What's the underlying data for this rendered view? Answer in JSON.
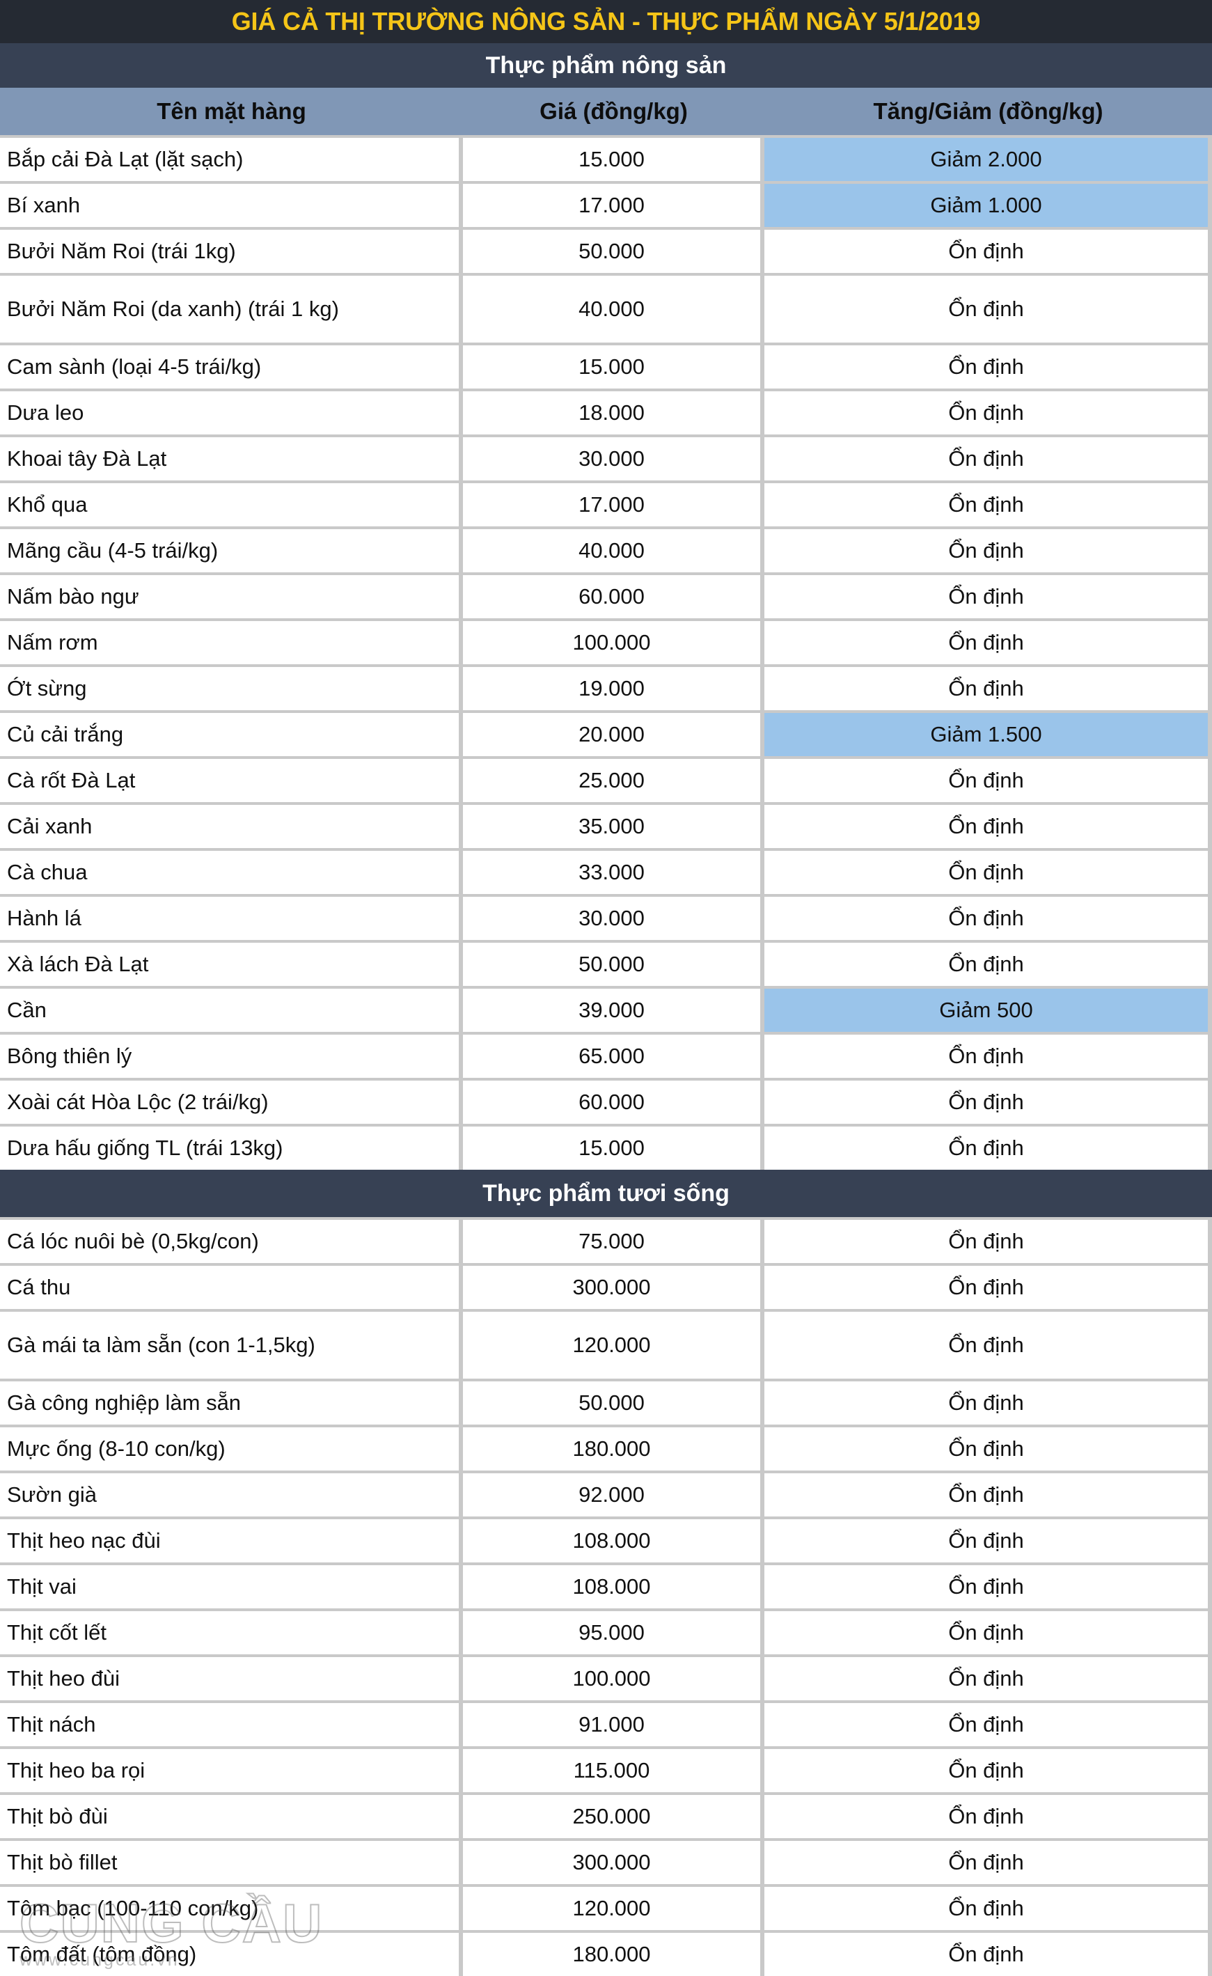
{
  "title": "GIÁ CẢ THỊ TRƯỜNG NÔNG SẢN - THỰC PHẨM NGÀY 5/1/2019",
  "colors": {
    "title_bar_bg": "#252a33",
    "title_text": "#f5c518",
    "section_bg": "#374154",
    "section_text": "#ffffff",
    "column_header_bg": "#8097b6",
    "highlight_bg": "#9ac4ea",
    "grid_bg": "#c9c9c9",
    "cell_bg": "#ffffff"
  },
  "columns": {
    "name": "Tên mặt hàng",
    "price": "Giá (đồng/kg)",
    "delta": "Tăng/Giảm (đồng/kg)"
  },
  "watermark": {
    "main": "CUNG CẦU",
    "sub": "www.cungcau.vn"
  },
  "sections": [
    {
      "heading": "Thực phẩm nông sản",
      "rows": [
        {
          "name": "Bắp cải Đà Lạt (lặt sạch)",
          "price": "15.000",
          "delta": "Giảm 2.000",
          "highlight": true
        },
        {
          "name": "Bí xanh",
          "price": "17.000",
          "delta": "Giảm 1.000",
          "highlight": true
        },
        {
          "name": "Bưởi Năm Roi (trái 1kg)",
          "price": "50.000",
          "delta": "Ổn định",
          "highlight": false
        },
        {
          "name": "Bưởi Năm Roi (da xanh) (trái 1 kg)",
          "price": "40.000",
          "delta": "Ổn định",
          "highlight": false,
          "two_line": true
        },
        {
          "name": "Cam sành (loại 4-5 trái/kg)",
          "price": "15.000",
          "delta": "Ổn định",
          "highlight": false
        },
        {
          "name": "Dưa leo",
          "price": "18.000",
          "delta": "Ổn định",
          "highlight": false
        },
        {
          "name": "Khoai tây Đà Lạt",
          "price": "30.000",
          "delta": "Ổn định",
          "highlight": false
        },
        {
          "name": "Khổ qua",
          "price": "17.000",
          "delta": "Ổn định",
          "highlight": false
        },
        {
          "name": "Mãng cầu (4-5 trái/kg)",
          "price": "40.000",
          "delta": "Ổn định",
          "highlight": false
        },
        {
          "name": "Nấm bào ngư",
          "price": "60.000",
          "delta": "Ổn định",
          "highlight": false
        },
        {
          "name": "Nấm rơm",
          "price": "100.000",
          "delta": "Ổn định",
          "highlight": false
        },
        {
          "name": "Ớt sừng",
          "price": "19.000",
          "delta": "Ổn định",
          "highlight": false
        },
        {
          "name": "Củ cải trắng",
          "price": "20.000",
          "delta": "Giảm 1.500",
          "highlight": true
        },
        {
          "name": "Cà rốt Đà Lạt",
          "price": "25.000",
          "delta": "Ổn định",
          "highlight": false
        },
        {
          "name": "Cải xanh",
          "price": "35.000",
          "delta": "Ổn định",
          "highlight": false
        },
        {
          "name": "Cà chua",
          "price": "33.000",
          "delta": "Ổn định",
          "highlight": false
        },
        {
          "name": "Hành lá",
          "price": "30.000",
          "delta": "Ổn định",
          "highlight": false
        },
        {
          "name": "Xà lách Đà Lạt",
          "price": "50.000",
          "delta": "Ổn định",
          "highlight": false
        },
        {
          "name": "Cần",
          "price": "39.000",
          "delta": "Giảm 500",
          "highlight": true
        },
        {
          "name": "Bông thiên lý",
          "price": "65.000",
          "delta": "Ổn định",
          "highlight": false
        },
        {
          "name": "Xoài cát Hòa Lộc (2 trái/kg)",
          "price": "60.000",
          "delta": "Ổn định",
          "highlight": false
        },
        {
          "name": "Dưa hấu giống TL (trái 13kg)",
          "price": "15.000",
          "delta": "Ổn định",
          "highlight": false
        }
      ]
    },
    {
      "heading": "Thực phẩm tươi sống",
      "rows": [
        {
          "name": "Cá lóc nuôi bè (0,5kg/con)",
          "price": "75.000",
          "delta": "Ổn định",
          "highlight": false
        },
        {
          "name": "Cá thu",
          "price": "300.000",
          "delta": "Ổn định",
          "highlight": false
        },
        {
          "name": "Gà mái ta làm sẵn (con 1-1,5kg)",
          "price": "120.000",
          "delta": "Ổn định",
          "highlight": false,
          "two_line": true
        },
        {
          "name": "Gà công nghiệp làm sẵn",
          "price": "50.000",
          "delta": "Ổn định",
          "highlight": false
        },
        {
          "name": "Mực ống (8-10 con/kg)",
          "price": "180.000",
          "delta": "Ổn định",
          "highlight": false
        },
        {
          "name": "Sườn già",
          "price": "92.000",
          "delta": "Ổn định",
          "highlight": false
        },
        {
          "name": "Thịt heo nạc đùi",
          "price": "108.000",
          "delta": "Ổn định",
          "highlight": false
        },
        {
          "name": "Thịt vai",
          "price": "108.000",
          "delta": "Ổn định",
          "highlight": false
        },
        {
          "name": "Thịt cốt lết",
          "price": "95.000",
          "delta": "Ổn định",
          "highlight": false
        },
        {
          "name": "Thịt heo đùi",
          "price": "100.000",
          "delta": "Ổn định",
          "highlight": false
        },
        {
          "name": "Thịt nách",
          "price": "91.000",
          "delta": "Ổn định",
          "highlight": false
        },
        {
          "name": "Thịt heo ba rọi",
          "price": "115.000",
          "delta": "Ổn định",
          "highlight": false
        },
        {
          "name": "Thịt bò đùi",
          "price": "250.000",
          "delta": "Ổn định",
          "highlight": false
        },
        {
          "name": "Thịt bò fillet",
          "price": "300.000",
          "delta": "Ổn định",
          "highlight": false
        },
        {
          "name": "Tôm bạc (100-110 con/kg)",
          "price": "120.000",
          "delta": "Ổn định",
          "highlight": false
        },
        {
          "name": "Tôm đất (tôm đồng)",
          "price": "180.000",
          "delta": "Ổn định",
          "highlight": false
        }
      ]
    }
  ]
}
